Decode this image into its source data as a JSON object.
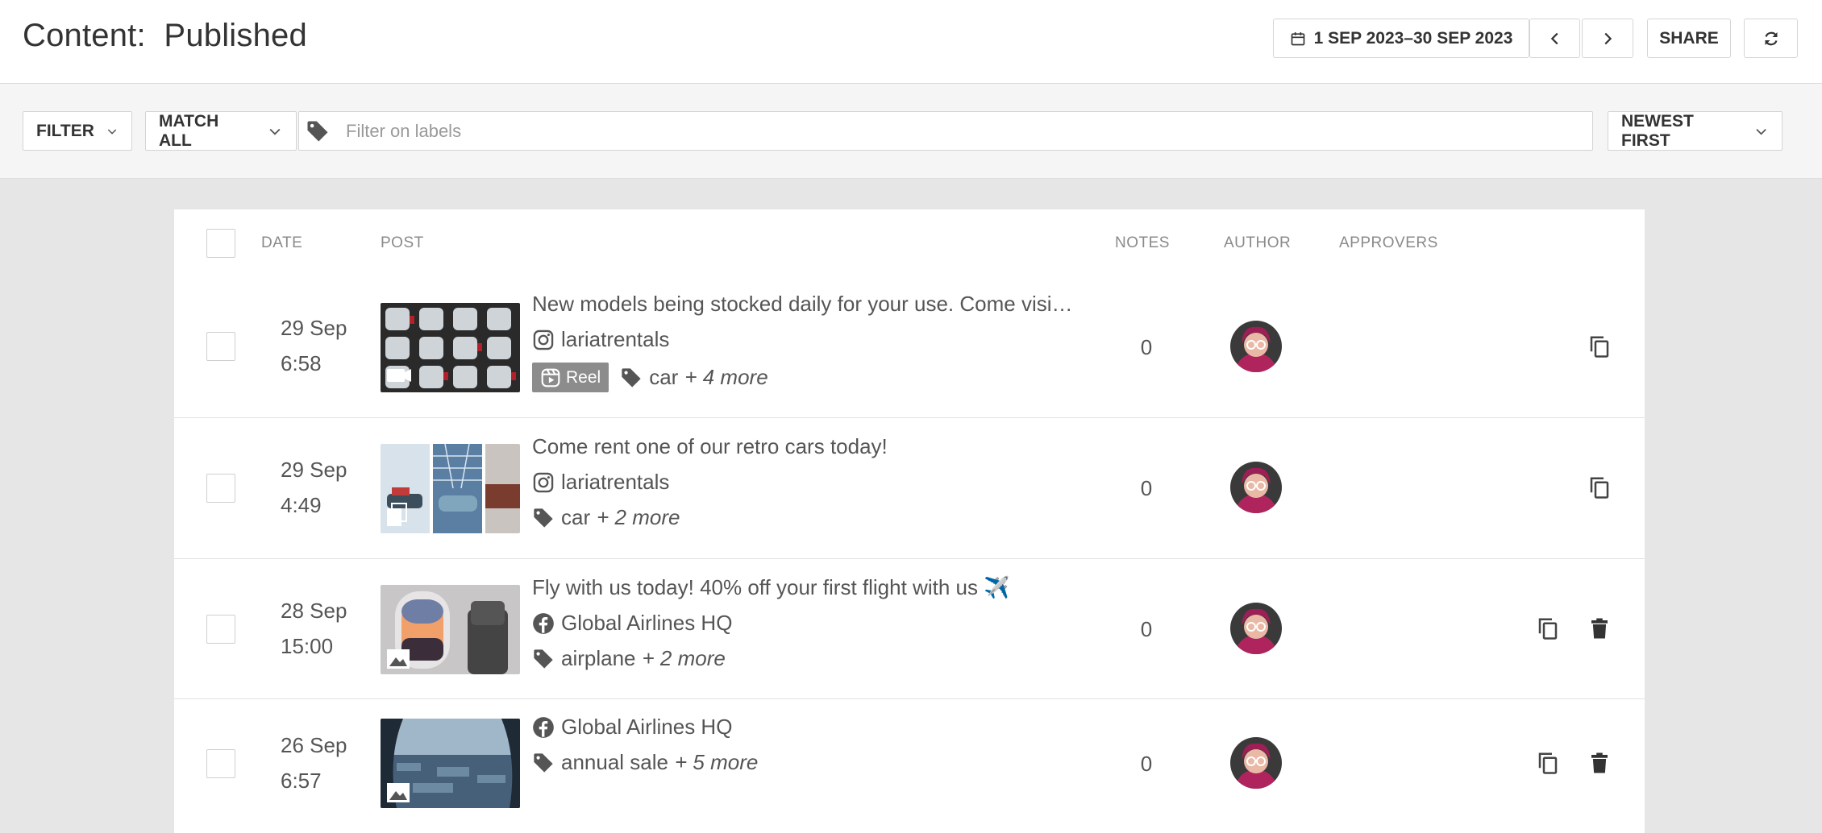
{
  "header": {
    "title": "Content:  Published",
    "date_range": "1 SEP 2023–30 SEP 2023",
    "share_label": "SHARE"
  },
  "filterbar": {
    "filter_label": "FILTER",
    "match_label": "MATCH ALL",
    "label_placeholder": "Filter on labels",
    "sort_label": "NEWEST FIRST"
  },
  "table": {
    "columns": {
      "date": "DATE",
      "post": "POST",
      "notes": "NOTES",
      "author": "AUTHOR",
      "approvers": "APPROVERS"
    },
    "rows": [
      {
        "day": "29 Sep",
        "time": "6:58",
        "text": "New models being stocked daily for your use. Come visi…",
        "network": "instagram",
        "account": "lariatrentals",
        "badge": "Reel",
        "label": "car",
        "more": "+ 4 more",
        "notes": "0",
        "actions": [
          "copy"
        ]
      },
      {
        "day": "29 Sep",
        "time": "4:49",
        "text": "Come rent one of our retro cars today!",
        "network": "instagram",
        "account": "lariatrentals",
        "label": "car",
        "more": "+ 2 more",
        "notes": "0",
        "actions": [
          "copy"
        ]
      },
      {
        "day": "28 Sep",
        "time": "15:00",
        "text": "Fly with us today! 40% off your first flight with us ✈️",
        "network": "facebook",
        "account": "Global Airlines HQ",
        "label": "airplane",
        "more": "+ 2 more",
        "notes": "0",
        "actions": [
          "copy",
          "delete"
        ]
      },
      {
        "day": "26 Sep",
        "time": "6:57",
        "network": "facebook",
        "account": "Global Airlines HQ",
        "label": "annual sale",
        "more": "+ 5 more",
        "notes": "0",
        "actions": [
          "copy",
          "delete"
        ]
      }
    ]
  },
  "colors": {
    "instagram": "#555555",
    "facebook": "#555555",
    "badge_bg": "#8c8c8c",
    "avatar_bg": "#b0245e"
  }
}
